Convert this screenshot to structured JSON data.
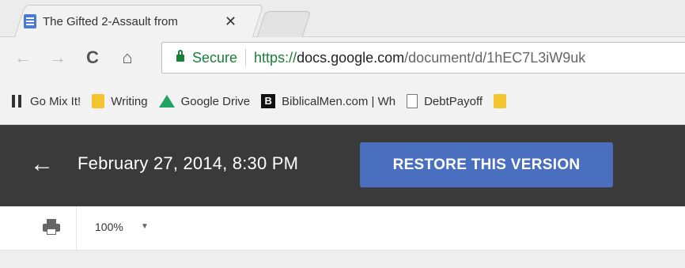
{
  "browser": {
    "tab": {
      "title": "The Gifted 2-Assault from",
      "close_glyph": "✕",
      "favicon": "docs-icon"
    },
    "nav": {
      "back_glyph": "←",
      "forward_glyph": "→",
      "reload_glyph": "C",
      "home_glyph": "⌂"
    },
    "omnibox": {
      "security_label": "Secure",
      "url_scheme": "https://",
      "url_host": "docs.google.com",
      "url_path": "/document/d/1hEC7L3iW9uk"
    },
    "bookmarks": [
      {
        "label": "Go Mix It!",
        "icon": "gomix-icon"
      },
      {
        "label": "Writing",
        "icon": "folder-icon"
      },
      {
        "label": "Google Drive",
        "icon": "drive-icon"
      },
      {
        "label": "BiblicalMen.com | Wh",
        "icon": "biblical-icon"
      },
      {
        "label": "DebtPayoff",
        "icon": "page-icon"
      }
    ]
  },
  "revision": {
    "back_glyph": "←",
    "date": "February 27, 2014, 8:30 PM",
    "restore_label": "RESTORE THIS VERSION",
    "restore_color": "#4a6fbf",
    "bar_color": "#3a3a3a"
  },
  "toolbar": {
    "zoom": "100%",
    "zoom_caret": "▼"
  }
}
